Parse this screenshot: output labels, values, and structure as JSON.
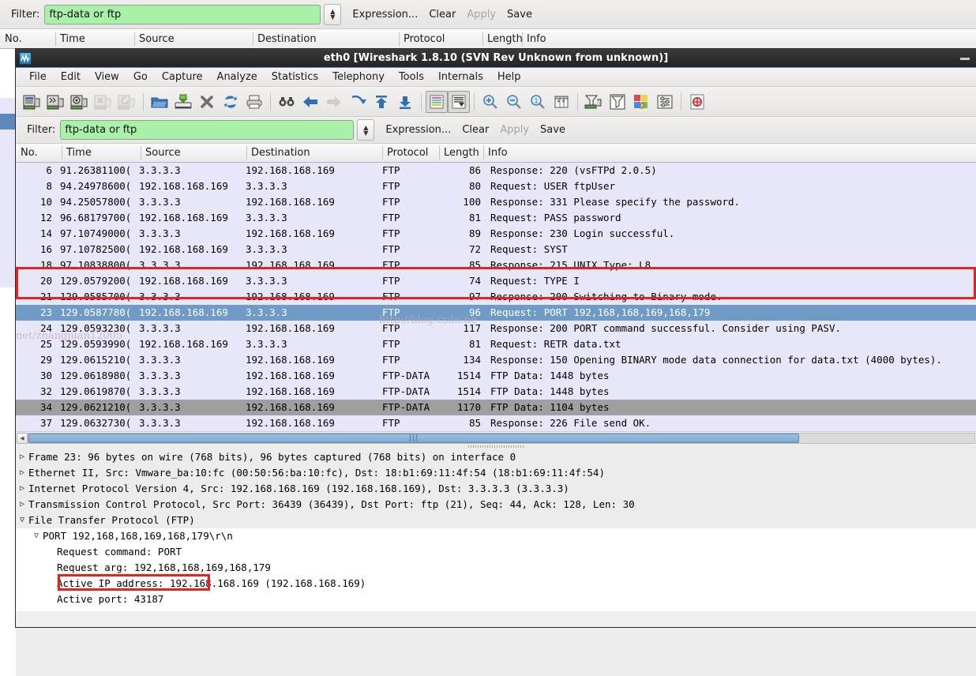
{
  "background_window": {
    "filter": {
      "label": "Filter:",
      "value": "ftp-data or ftp",
      "expression_label": "Expression...",
      "clear_label": "Clear",
      "apply_label": "Apply",
      "save_label": "Save"
    },
    "columns": [
      "No.",
      "Time",
      "Source",
      "Destination",
      "Protocol",
      "Length",
      "Info"
    ]
  },
  "window": {
    "title": "eth0   [Wireshark 1.8.10  (SVN Rev Unknown from unknown)]",
    "minimize_label": "_",
    "app_icon": "wireshark-icon"
  },
  "menu": {
    "items": [
      "File",
      "Edit",
      "View",
      "Go",
      "Capture",
      "Analyze",
      "Statistics",
      "Telephony",
      "Tools",
      "Internals",
      "Help"
    ]
  },
  "toolbar": {
    "items": [
      {
        "name": "interfaces-icon",
        "enabled": true
      },
      {
        "name": "capture-options-icon",
        "enabled": true
      },
      {
        "name": "start-capture-icon",
        "enabled": true
      },
      {
        "name": "stop-capture-icon",
        "enabled": false
      },
      {
        "name": "restart-capture-icon",
        "enabled": false
      },
      {
        "name": "open-file-icon",
        "enabled": true
      },
      {
        "name": "save-file-icon",
        "enabled": true
      },
      {
        "name": "close-file-icon",
        "enabled": true
      },
      {
        "name": "reload-icon",
        "enabled": true
      },
      {
        "name": "print-icon",
        "enabled": true
      },
      {
        "name": "find-packet-icon",
        "enabled": true
      },
      {
        "name": "go-back-icon",
        "enabled": true
      },
      {
        "name": "go-forward-icon",
        "enabled": false
      },
      {
        "name": "go-to-packet-icon",
        "enabled": true
      },
      {
        "name": "go-first-packet-icon",
        "enabled": true
      },
      {
        "name": "go-last-packet-icon",
        "enabled": true
      },
      {
        "name": "colorize-icon",
        "enabled": true,
        "pressed": true
      },
      {
        "name": "auto-scroll-icon",
        "enabled": true,
        "pressed": true
      },
      {
        "name": "zoom-in-icon",
        "enabled": true
      },
      {
        "name": "zoom-out-icon",
        "enabled": true
      },
      {
        "name": "zoom-normal-icon",
        "enabled": true
      },
      {
        "name": "resize-columns-icon",
        "enabled": true
      },
      {
        "name": "capture-filters-icon",
        "enabled": true
      },
      {
        "name": "display-filters-icon",
        "enabled": true
      },
      {
        "name": "coloring-rules-icon",
        "enabled": true
      },
      {
        "name": "preferences-icon",
        "enabled": true
      },
      {
        "name": "help-icon",
        "enabled": true
      }
    ]
  },
  "filter": {
    "label": "Filter:",
    "value": "ftp-data or ftp",
    "expression_label": "Expression...",
    "clear_label": "Clear",
    "apply_label": "Apply",
    "save_label": "Save"
  },
  "packet_list": {
    "columns": [
      "No.",
      "Time",
      "Source",
      "Destination",
      "Protocol",
      "Length",
      "Info"
    ],
    "rows": [
      {
        "no": "6",
        "time": "91.26381100(",
        "src": "3.3.3.3",
        "dst": "192.168.168.169",
        "proto": "FTP",
        "len": "86",
        "info": "Response: 220 (vsFTPd 2.0.5)",
        "state": "normal"
      },
      {
        "no": "8",
        "time": "94.24978600(",
        "src": "192.168.168.169",
        "dst": "3.3.3.3",
        "proto": "FTP",
        "len": "80",
        "info": "Request: USER ftpUser",
        "state": "normal"
      },
      {
        "no": "10",
        "time": "94.25057800(",
        "src": "3.3.3.3",
        "dst": "192.168.168.169",
        "proto": "FTP",
        "len": "100",
        "info": "Response: 331 Please specify the password.",
        "state": "normal"
      },
      {
        "no": "12",
        "time": "96.68179700(",
        "src": "192.168.168.169",
        "dst": "3.3.3.3",
        "proto": "FTP",
        "len": "81",
        "info": "Request: PASS password",
        "state": "normal"
      },
      {
        "no": "14",
        "time": "97.10749000(",
        "src": "3.3.3.3",
        "dst": "192.168.168.169",
        "proto": "FTP",
        "len": "89",
        "info": "Response: 230 Login successful.",
        "state": "normal"
      },
      {
        "no": "16",
        "time": "97.10782500(",
        "src": "192.168.168.169",
        "dst": "3.3.3.3",
        "proto": "FTP",
        "len": "72",
        "info": "Request: SYST",
        "state": "normal"
      },
      {
        "no": "18",
        "time": "97.10838800(",
        "src": "3.3.3.3",
        "dst": "192.168.168.169",
        "proto": "FTP",
        "len": "85",
        "info": "Response: 215 UNIX Type: L8",
        "state": "normal"
      },
      {
        "no": "20",
        "time": "129.0579200(",
        "src": "192.168.168.169",
        "dst": "3.3.3.3",
        "proto": "FTP",
        "len": "74",
        "info": "Request: TYPE I",
        "state": "normal"
      },
      {
        "no": "21",
        "time": "129.0585700(",
        "src": "3.3.3.3",
        "dst": "192.168.168.169",
        "proto": "FTP",
        "len": "97",
        "info": "Response: 200 Switching to Binary mode.",
        "state": "normal"
      },
      {
        "no": "23",
        "time": "129.0587780(",
        "src": "192.168.168.169",
        "dst": "3.3.3.3",
        "proto": "FTP",
        "len": "96",
        "info": "Request: PORT 192,168,168,169,168,179",
        "state": "selected"
      },
      {
        "no": "24",
        "time": "129.0593230(",
        "src": "3.3.3.3",
        "dst": "192.168.168.169",
        "proto": "FTP",
        "len": "117",
        "info": "Response: 200 PORT command successful. Consider using PASV.",
        "state": "normal"
      },
      {
        "no": "25",
        "time": "129.0593990(",
        "src": "192.168.168.169",
        "dst": "3.3.3.3",
        "proto": "FTP",
        "len": "81",
        "info": "Request: RETR data.txt",
        "state": "normal"
      },
      {
        "no": "29",
        "time": "129.0615210(",
        "src": "3.3.3.3",
        "dst": "192.168.168.169",
        "proto": "FTP",
        "len": "134",
        "info": "Response: 150 Opening BINARY mode data connection for data.txt (4000 bytes).",
        "state": "normal"
      },
      {
        "no": "30",
        "time": "129.0618980(",
        "src": "3.3.3.3",
        "dst": "192.168.168.169",
        "proto": "FTP-DATA",
        "len": "1514",
        "info": "FTP Data: 1448 bytes",
        "state": "normal"
      },
      {
        "no": "32",
        "time": "129.0619870(",
        "src": "3.3.3.3",
        "dst": "192.168.168.169",
        "proto": "FTP-DATA",
        "len": "1514",
        "info": "FTP Data: 1448 bytes",
        "state": "normal"
      },
      {
        "no": "34",
        "time": "129.0621210(",
        "src": "3.3.3.3",
        "dst": "192.168.168.169",
        "proto": "FTP-DATA",
        "len": "1170",
        "info": "FTP Data: 1104 bytes",
        "state": "grey"
      },
      {
        "no": "37",
        "time": "129.0632730(",
        "src": "3.3.3.3",
        "dst": "192.168.168.169",
        "proto": "FTP",
        "len": "85",
        "info": "Response: 226 File send OK.",
        "state": "normal"
      }
    ]
  },
  "detail_tree": [
    {
      "indent": 0,
      "twisty": "collapsed",
      "text": "Frame 23: 96 bytes on wire (768 bits), 96 bytes captured (768 bits) on interface 0"
    },
    {
      "indent": 0,
      "twisty": "collapsed",
      "text": "Ethernet II, Src: Vmware_ba:10:fc (00:50:56:ba:10:fc), Dst: 18:b1:69:11:4f:54 (18:b1:69:11:4f:54)"
    },
    {
      "indent": 0,
      "twisty": "collapsed",
      "text": "Internet Protocol Version 4, Src: 192.168.168.169 (192.168.168.169), Dst: 3.3.3.3 (3.3.3.3)"
    },
    {
      "indent": 0,
      "twisty": "collapsed",
      "text": "Transmission Control Protocol, Src Port: 36439 (36439), Dst Port: ftp (21), Seq: 44, Ack: 128, Len: 30"
    },
    {
      "indent": 0,
      "twisty": "expanded",
      "text": "File Transfer Protocol (FTP)"
    },
    {
      "indent": 1,
      "twisty": "expanded",
      "text": "PORT 192,168,168,169,168,179\\r\\n"
    },
    {
      "indent": 2,
      "twisty": "none",
      "text": "Request command: PORT"
    },
    {
      "indent": 2,
      "twisty": "none",
      "text": "Request arg: 192,168,168,169,168,179"
    },
    {
      "indent": 2,
      "twisty": "none",
      "text": "Active IP address: 192.168.168.169 (192.168.168.169)"
    },
    {
      "indent": 2,
      "twisty": "none",
      "text": "Active port: 43187"
    }
  ],
  "annotations": [
    {
      "name": "port-request-response-highlight"
    },
    {
      "name": "active-port-highlight"
    }
  ],
  "watermarks": [
    {
      "text": "http://blog.csdn.ne"
    },
    {
      "text": "net/zhangjuan12005"
    }
  ],
  "colors": {
    "filter_valid": "#a9f0a9",
    "row_default": "#e7e7fa",
    "row_selected": "#6f9bc6",
    "row_grey": "#9f9f9f",
    "annotation_red": "#e8221b",
    "title_bar": "#2c2c2c"
  }
}
